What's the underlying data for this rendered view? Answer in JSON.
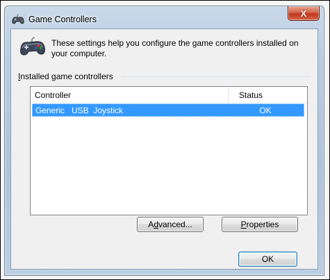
{
  "window": {
    "title": "Game Controllers",
    "close_label": "X"
  },
  "header": {
    "description": "These settings help you configure the game controllers installed on your computer."
  },
  "group": {
    "label_prefix": "",
    "label_mnemonic": "I",
    "label_rest": "nstalled game controllers"
  },
  "list": {
    "columns": [
      "Controller",
      "Status"
    ],
    "rows": [
      {
        "controller": "Generic   USB  Joystick",
        "status": "OK",
        "selected": true
      }
    ]
  },
  "buttons": {
    "advanced_pre": "A",
    "advanced_mnemonic": "d",
    "advanced_post": "vanced...",
    "properties_mnemonic": "P",
    "properties_post": "roperties",
    "ok": "OK"
  },
  "icons": {
    "title": "gamepad-icon",
    "header": "gamepad-icon"
  }
}
